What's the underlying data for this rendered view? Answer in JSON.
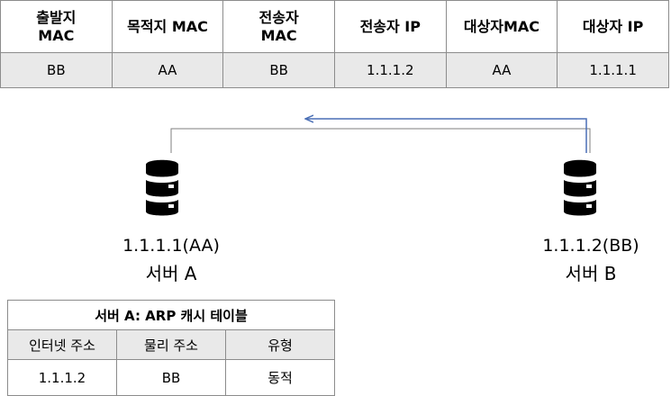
{
  "packet": {
    "headers": [
      "출발지\nMAC",
      "목적지 MAC",
      "전송자\nMAC",
      "전송자 IP",
      "대상자MAC",
      "대상자 IP"
    ],
    "values": [
      "BB",
      "AA",
      "BB",
      "1.1.1.2",
      "AA",
      "1.1.1.1"
    ]
  },
  "servers": {
    "a": {
      "ip": "1.1.1.1(AA)",
      "name": "서버 A"
    },
    "b": {
      "ip": "1.1.1.2(BB)",
      "name": "서버 B"
    }
  },
  "arp_cache": {
    "title": "서버 A: ARP 캐시 테이블",
    "headers": [
      "인터넷 주소",
      "물리 주소",
      "유형"
    ],
    "row": [
      "1.1.1.2",
      "BB",
      "동적"
    ]
  },
  "colors": {
    "arrow": "#4a6fb5",
    "line": "#7f7f7f",
    "cell_fill": "#e9e9e9",
    "server_icon": "#000000"
  },
  "icons": {
    "server": "database-server-icon"
  }
}
